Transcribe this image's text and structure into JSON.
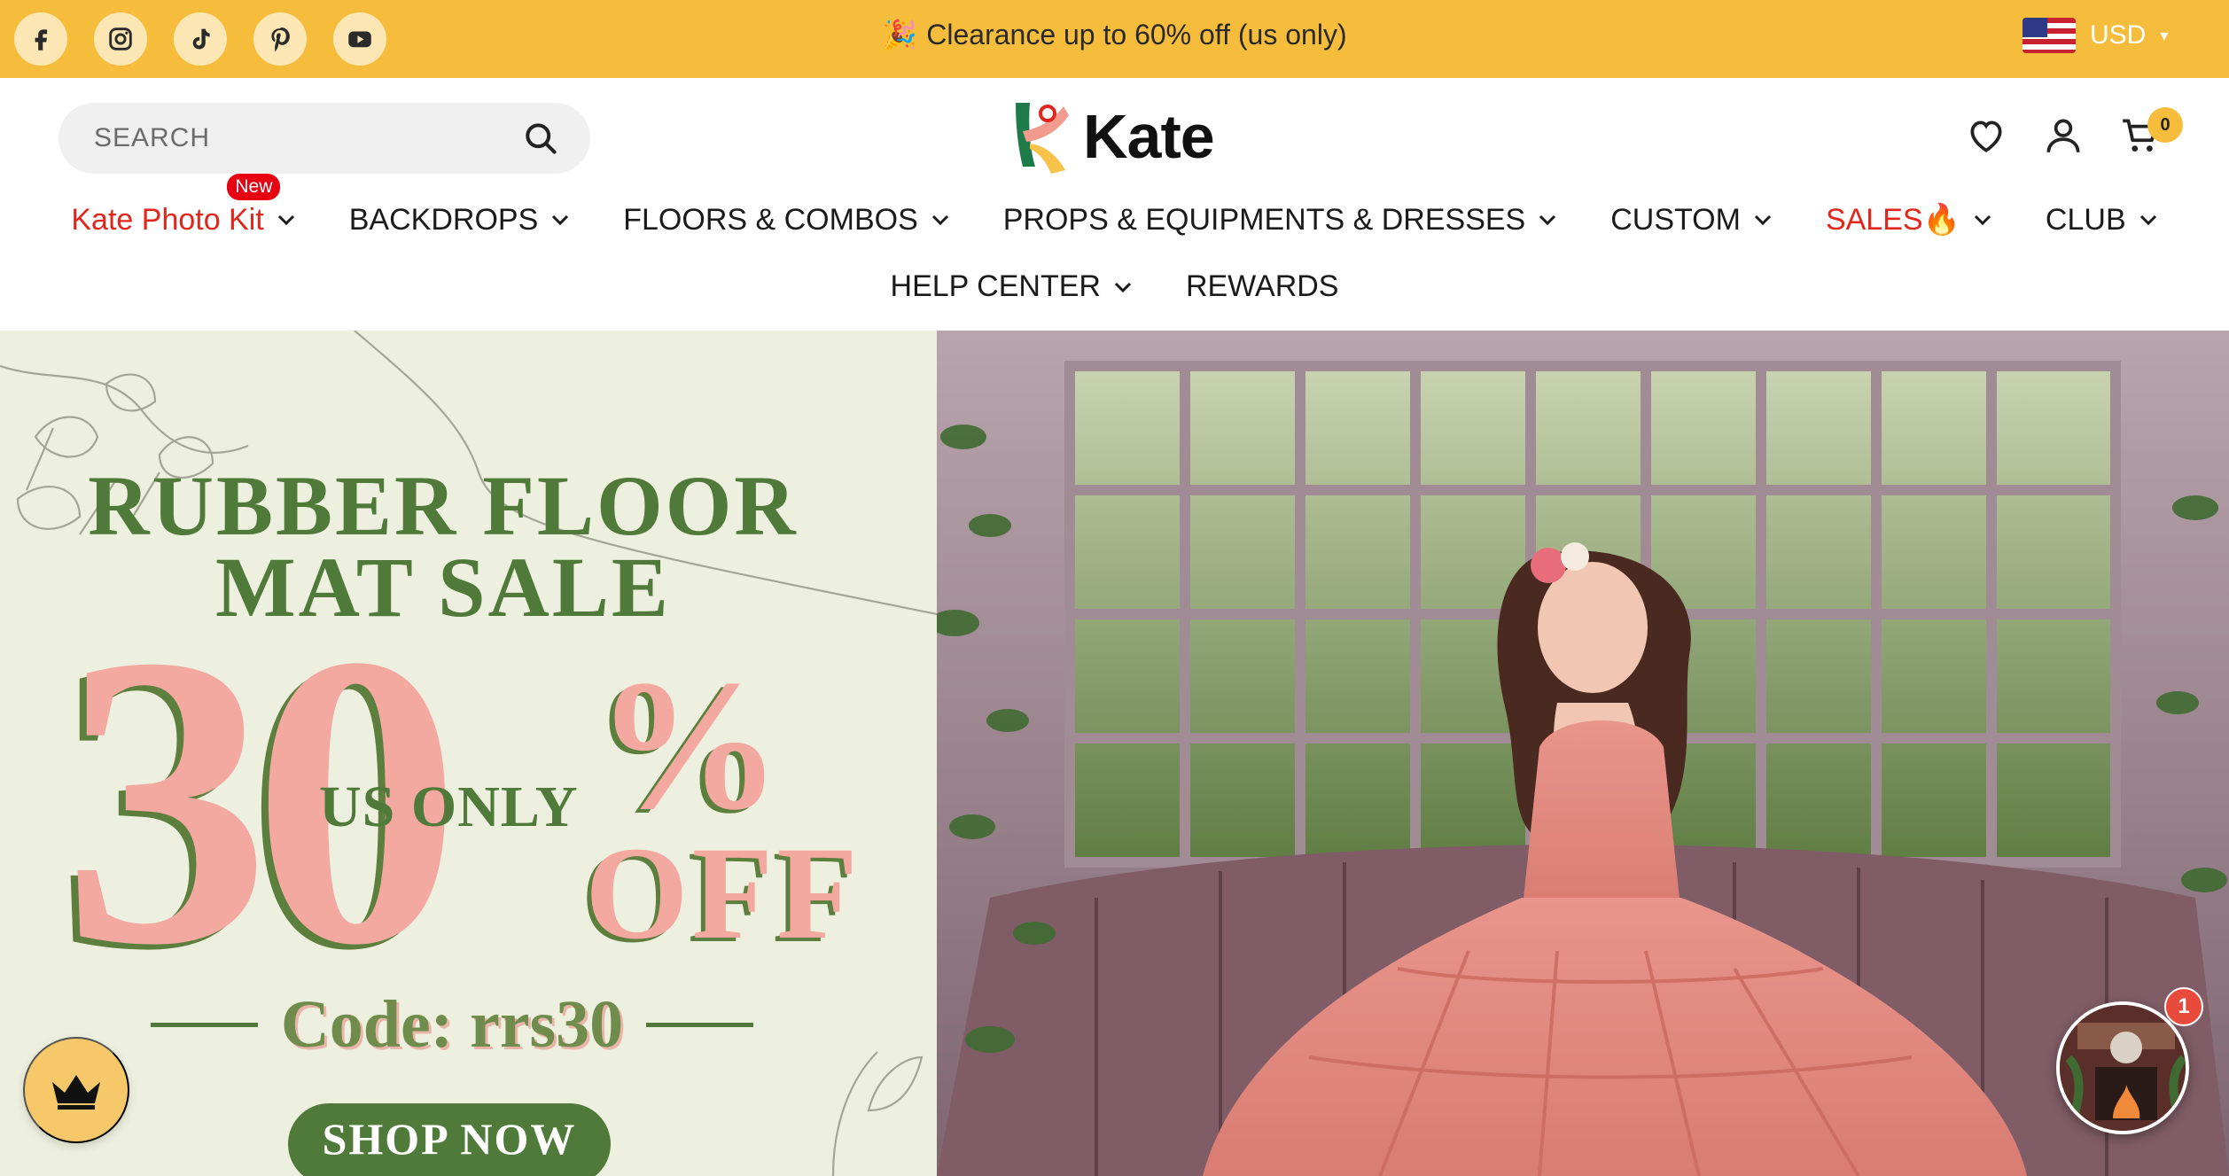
{
  "topbar": {
    "social": [
      {
        "name": "facebook-icon"
      },
      {
        "name": "instagram-icon"
      },
      {
        "name": "tiktok-icon"
      },
      {
        "name": "pinterest-icon"
      },
      {
        "name": "youtube-icon"
      }
    ],
    "announcement": "Clearance up to 60% off (us only)",
    "announcement_icon": "🎉",
    "currency": "USD",
    "currency_flag": "us-flag-icon"
  },
  "header": {
    "search_placeholder": "SEARCH",
    "logo_text": "Kate",
    "cart_count": "0"
  },
  "nav": {
    "row1": [
      {
        "label": "Kate Photo Kit",
        "badge": "New",
        "color": "#e1261c"
      },
      {
        "label": "BACKDROPS"
      },
      {
        "label": "FLOORS & COMBOS"
      },
      {
        "label": "PROPS & EQUIPMENTS & DRESSES"
      },
      {
        "label": "CUSTOM"
      },
      {
        "label": "SALES🔥",
        "color": "#e1261c"
      },
      {
        "label": "CLUB"
      }
    ],
    "row2": [
      {
        "label": "HELP CENTER"
      },
      {
        "label": "REWARDS"
      }
    ]
  },
  "hero": {
    "title_line1": "RUBBER FLOOR",
    "title_line2": "MAT SALE",
    "discount_number": "30",
    "percent": "%",
    "off": "OFF",
    "region": "US ONLY",
    "code": "Code: rrs30",
    "cta": "SHOP NOW"
  },
  "widgets": {
    "chat_badge": "1"
  },
  "colors": {
    "announcement_bg": "#f6bd3c",
    "promo_green": "#4f7a3a",
    "promo_pink": "#f3a8a0",
    "accent_red": "#e1261c"
  }
}
